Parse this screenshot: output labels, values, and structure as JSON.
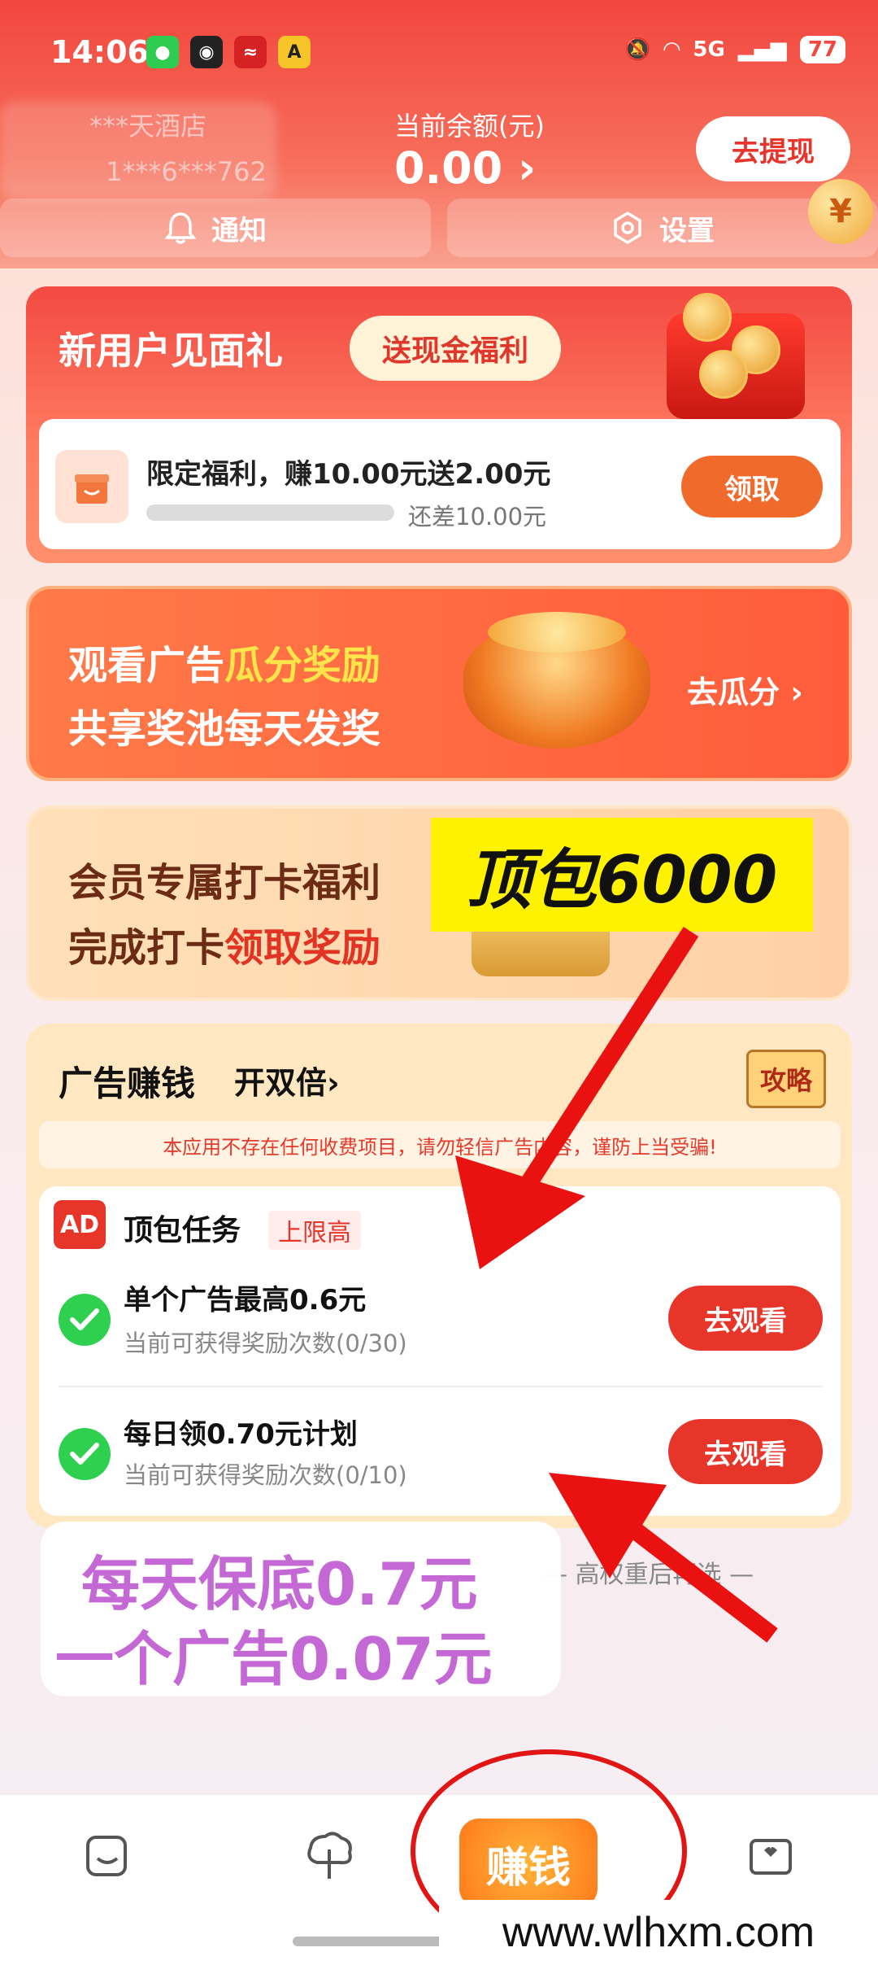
{
  "status": {
    "time": "14:06",
    "battery": "77",
    "signal_label": "5G"
  },
  "header": {
    "store_name": "***天酒店",
    "store_id": "1***6***762",
    "balance_label": "当前余额(元)",
    "balance_value": "0.00 ›",
    "withdraw_label": "去提现",
    "notify_label": "通知",
    "settings_label": "设置"
  },
  "new_user": {
    "title": "新用户见面礼",
    "pill": "送现金福利",
    "task_text": "限定福利，赚10.00元送2.00元",
    "progress": 0,
    "remain_text": "还差10.00元",
    "claim_label": "领取"
  },
  "watch_ad": {
    "line1_a": "观看广告",
    "line1_b": "瓜分奖励",
    "line2": "共享奖池每天发奖",
    "go_label": "去瓜分 ›"
  },
  "member": {
    "line1": "会员专属打卡福利",
    "line2_a": "完成打卡",
    "line2_b": "领取奖励",
    "overlay": "顶包6000"
  },
  "ads": {
    "title": "广告赚钱",
    "double_label": "开双倍›",
    "guide_label": "攻略",
    "notice": "本应用不存在任何收费项目，请勿轻信广告内容，谨防上当受骗!",
    "badge": "AD",
    "task_group_title": "顶包任务",
    "task_group_limit": "上限高",
    "tasks": [
      {
        "name": "单个广告最高0.6元",
        "sub": "当前可获得奖励次数(0/30)",
        "button": "去观看"
      },
      {
        "name": "每日领0.70元计划",
        "sub": "当前可获得奖励次数(0/10)",
        "button": "去观看"
      }
    ],
    "footnote": "— 高权重后再选 —"
  },
  "promo_overlay": {
    "line1": "每天保底0.7元",
    "line2": "一个广告0.07元"
  },
  "nav": {
    "earn_label": "赚钱"
  },
  "watermark": "www.wlhxm.com",
  "colors": {
    "brand_red": "#f2463f",
    "accent_orange": "#f06a2c",
    "success_green": "#2fd04f"
  }
}
